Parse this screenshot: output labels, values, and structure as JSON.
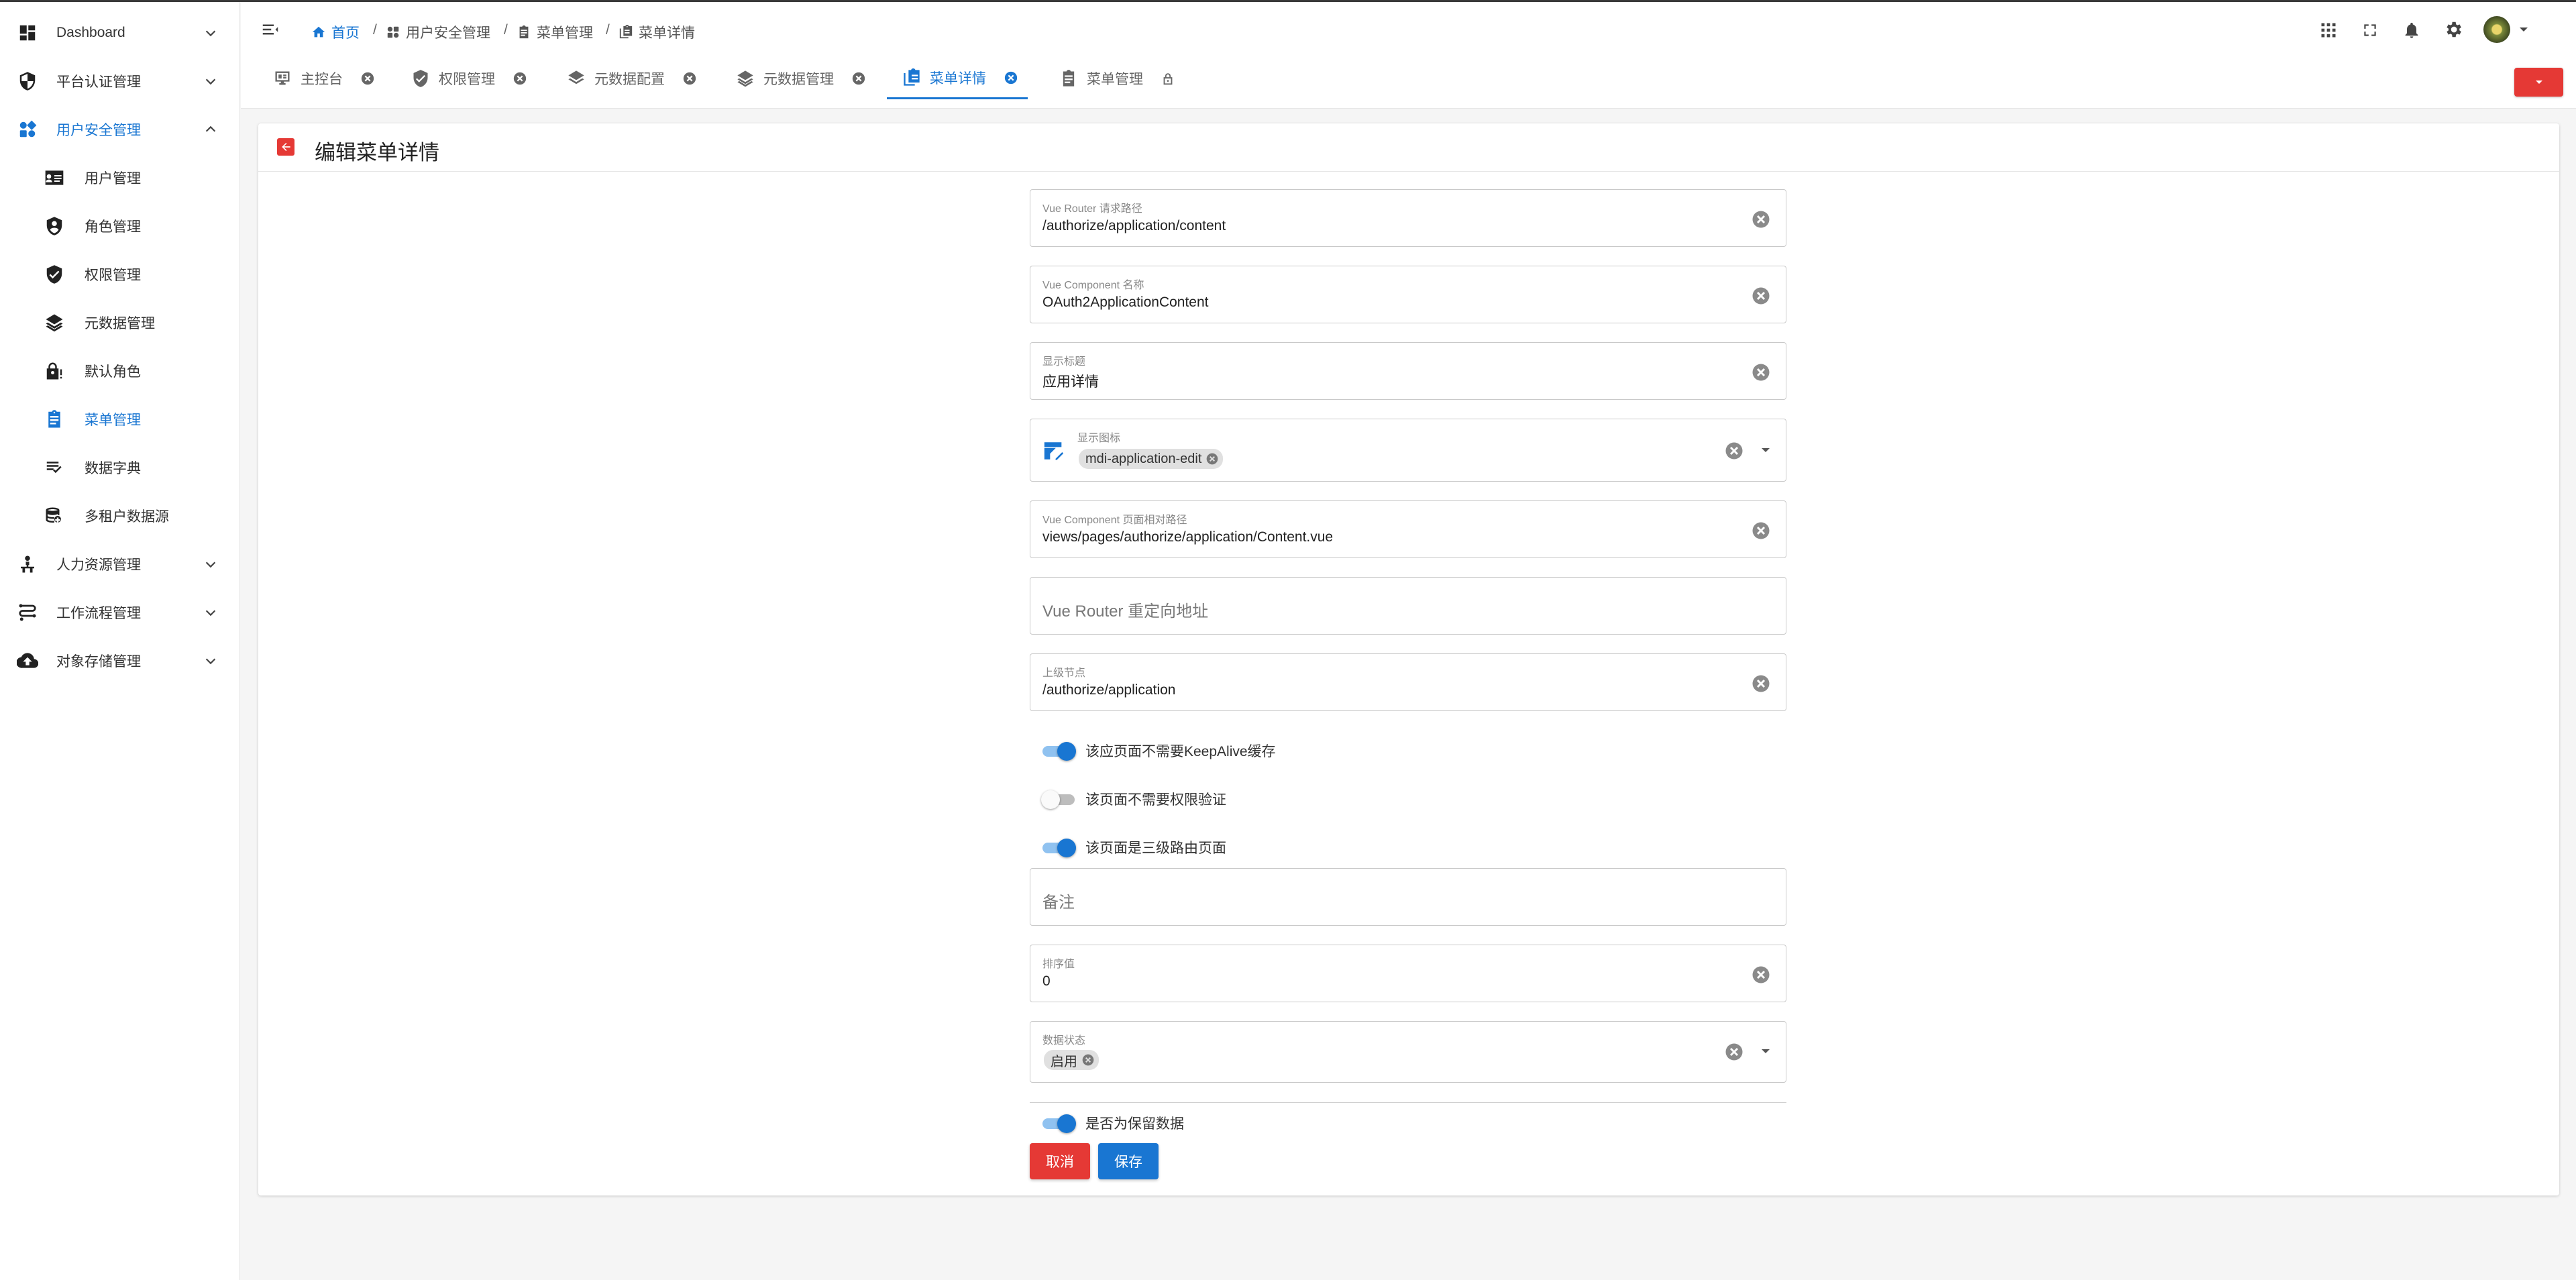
{
  "sidebar": {
    "items": [
      {
        "label": "Dashboard",
        "icon": "dashboard-icon"
      },
      {
        "label": "平台认证管理",
        "icon": "shield-icon"
      },
      {
        "label": "用户安全管理",
        "icon": "apps-icon",
        "active": true
      },
      {
        "label": "人力资源管理",
        "icon": "account-tree-icon"
      },
      {
        "label": "工作流程管理",
        "icon": "workflow-icon"
      },
      {
        "label": "对象存储管理",
        "icon": "cloud-upload-icon"
      }
    ],
    "sub_items": [
      {
        "label": "用户管理",
        "icon": "account-card-icon"
      },
      {
        "label": "角色管理",
        "icon": "account-shield-icon"
      },
      {
        "label": "权限管理",
        "icon": "shield-check-icon"
      },
      {
        "label": "元数据管理",
        "icon": "layers-icon"
      },
      {
        "label": "默认角色",
        "icon": "lock-account-icon"
      },
      {
        "label": "菜单管理",
        "icon": "clipboard-list-icon",
        "active": true
      },
      {
        "label": "数据字典",
        "icon": "format-list-checks-icon"
      },
      {
        "label": "多租户数据源",
        "icon": "database-icon"
      }
    ]
  },
  "header": {
    "breadcrumb": [
      "首页",
      "用户安全管理",
      "菜单管理",
      "菜单详情"
    ],
    "separator": "/"
  },
  "tabs": [
    {
      "label": "主控台",
      "icon": "monitor-icon",
      "closable": true
    },
    {
      "label": "权限管理",
      "icon": "shield-check-icon",
      "closable": true
    },
    {
      "label": "元数据配置",
      "icon": "layers-icon",
      "closable": true
    },
    {
      "label": "元数据管理",
      "icon": "layers-icon",
      "closable": true
    },
    {
      "label": "菜单详情",
      "icon": "clipboard-list-icon",
      "closable": true,
      "active": true
    },
    {
      "label": "菜单管理",
      "icon": "clipboard-list-icon",
      "locked": true
    }
  ],
  "page": {
    "title": "编辑菜单详情"
  },
  "form": {
    "router_path": {
      "label": "Vue Router 请求路径",
      "value": "/authorize/application/content"
    },
    "component_name": {
      "label": "Vue Component 名称",
      "value": "OAuth2ApplicationContent"
    },
    "display_title": {
      "label": "显示标题",
      "value": "应用详情"
    },
    "display_icon": {
      "label": "显示图标",
      "value": "mdi-application-edit"
    },
    "component_path": {
      "label": "Vue Component 页面相对路径",
      "value": "views/pages/authorize/application/Content.vue"
    },
    "redirect": {
      "placeholder": "Vue Router 重定向地址"
    },
    "parent_node": {
      "label": "上级节点",
      "value": "/authorize/application"
    },
    "switches": [
      {
        "label": "该应页面不需要KeepAlive缓存",
        "on": true
      },
      {
        "label": "该页面不需要权限验证",
        "on": false
      },
      {
        "label": "该页面是三级路由页面",
        "on": true
      }
    ],
    "remark": {
      "placeholder": "备注"
    },
    "sort_value": {
      "label": "排序值",
      "value": "0"
    },
    "data_status": {
      "label": "数据状态",
      "value": "启用"
    },
    "reserved_switch": {
      "label": "是否为保留数据",
      "on": true
    },
    "cancel_label": "取消",
    "save_label": "保存"
  },
  "colors": {
    "primary": "#1976d2",
    "danger": "#e53935",
    "background": "#f5f5f5"
  }
}
